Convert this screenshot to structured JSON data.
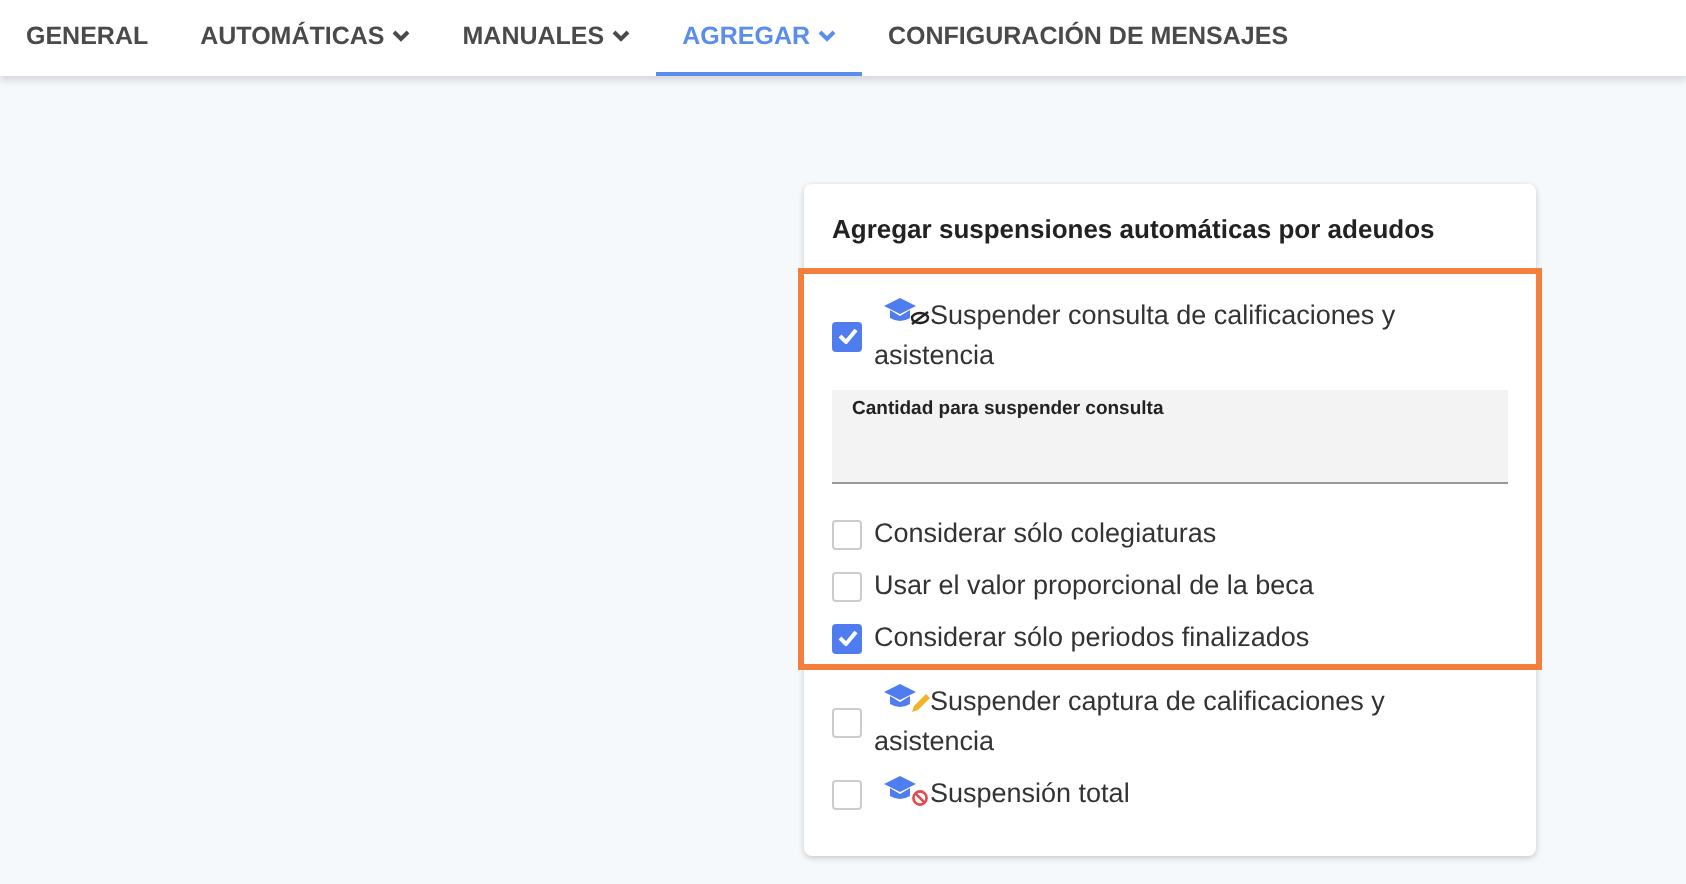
{
  "tabs": [
    {
      "label": "GENERAL",
      "dropdown": false,
      "selected": false
    },
    {
      "label": "AUTOMÁTICAS",
      "dropdown": true,
      "selected": false
    },
    {
      "label": "MANUALES",
      "dropdown": true,
      "selected": false
    },
    {
      "label": "AGREGAR",
      "dropdown": true,
      "selected": true
    },
    {
      "label": "CONFIGURACIÓN DE MENSAJES",
      "dropdown": false,
      "selected": false
    }
  ],
  "card": {
    "title": "Agregar suspensiones automáticas por adeudos",
    "sections": [
      {
        "highlighted": true,
        "items": [
          {
            "kind": "hidden-grades",
            "label": "Suspender consulta de calificaciones y asistencia",
            "checked": true
          },
          {
            "kind": "field",
            "placeholder": "Cantidad para suspender consulta"
          },
          {
            "kind": "option",
            "label": "Considerar sólo colegiaturas",
            "checked": false
          },
          {
            "kind": "option",
            "label": "Usar el valor proporcional de la beca",
            "checked": false
          },
          {
            "kind": "option",
            "label": "Considerar sólo periodos finalizados",
            "checked": true
          }
        ]
      },
      {
        "highlighted": false,
        "items": [
          {
            "kind": "edit-grades",
            "label": "Suspender captura de calificaciones y asistencia",
            "checked": false
          },
          {
            "kind": "block-grades",
            "label": "Suspensión total",
            "checked": false
          }
        ]
      }
    ]
  }
}
